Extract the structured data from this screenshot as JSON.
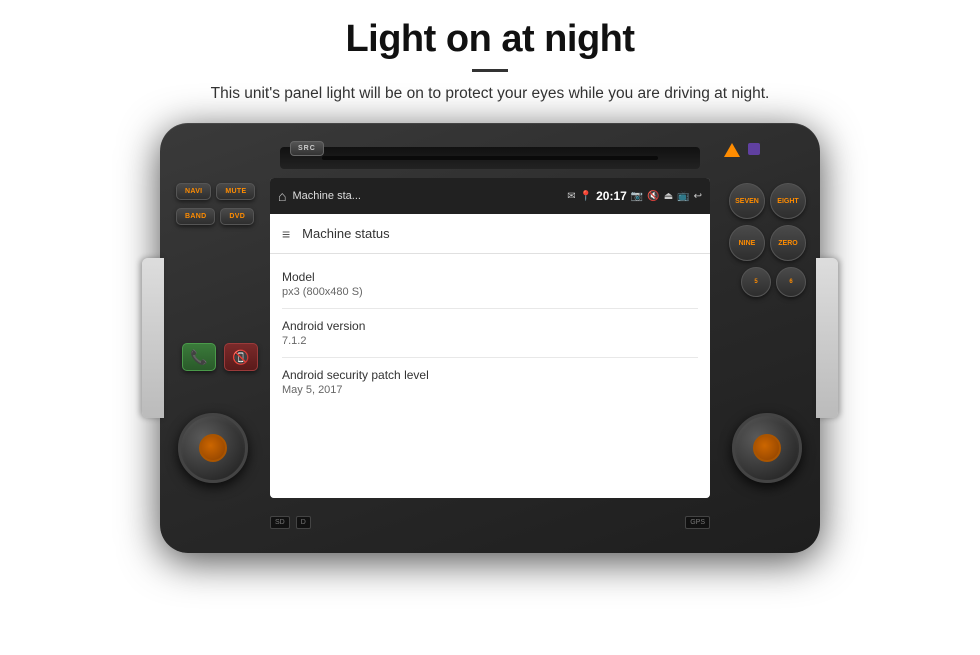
{
  "header": {
    "title": "Light on at night",
    "subtitle": "This unit's panel light will be on to protect your eyes while you are driving at night."
  },
  "device": {
    "buttons": {
      "left": [
        {
          "label": "SRC"
        },
        {
          "label": "NAVI"
        },
        {
          "label": "MUTE"
        },
        {
          "label": "BAND"
        },
        {
          "label": "DVD"
        }
      ],
      "right": [
        {
          "label": "SEVEN"
        },
        {
          "label": "EIGHT"
        },
        {
          "label": "NINE"
        },
        {
          "label": "ZERO"
        },
        {
          "label": "5"
        },
        {
          "label": "6"
        }
      ]
    },
    "bottom_labels": {
      "sd": "SD",
      "d": "D",
      "gps": "GPS"
    }
  },
  "screen": {
    "status_bar": {
      "app_name": "Machine sta...",
      "time": "20:17"
    },
    "toolbar": {
      "title": "Machine status"
    },
    "status_items": [
      {
        "label": "Model",
        "value": "px3 (800x480 S)"
      },
      {
        "label": "Android version",
        "value": "7.1.2"
      },
      {
        "label": "Android security patch level",
        "value": "May 5, 2017"
      }
    ]
  }
}
